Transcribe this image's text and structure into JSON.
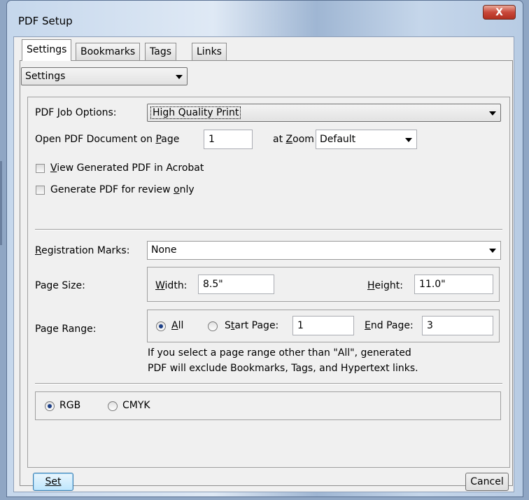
{
  "window": {
    "title": "PDF Setup",
    "close_glyph": "X"
  },
  "tabs": [
    {
      "label": "Settings",
      "active": true
    },
    {
      "label": "Bookmarks",
      "active": false
    },
    {
      "label": "Tags",
      "active": false
    },
    {
      "label": "Links",
      "active": false
    }
  ],
  "category_select": {
    "value": "Settings"
  },
  "job_options": {
    "label": "PDF Job Options:",
    "label_mnemonic": "J",
    "value": "High Quality Print"
  },
  "open_on_page": {
    "label": "Open PDF Document on Page",
    "page_value": "1",
    "zoom_label": "at Zoom",
    "zoom_value": "Default"
  },
  "checkboxes": [
    {
      "label": "View Generated PDF in Acrobat",
      "checked": false
    },
    {
      "label": "Generate PDF for review only",
      "checked": false
    }
  ],
  "registration": {
    "label": "Registration Marks:",
    "value": "None"
  },
  "page_size": {
    "label": "Page Size:",
    "width_label": "Width:",
    "width_value": "8.5\"",
    "height_label": "Height:",
    "height_value": "11.0\""
  },
  "page_range": {
    "label": "Page Range:",
    "all_label": "All",
    "start_label": "Start Page:",
    "start_value": "1",
    "end_label": "End Page:",
    "end_value": "3",
    "selected": "All",
    "note_line1": "If you select a page range other than \"All\",  generated",
    "note_line2": "PDF will exclude Bookmarks, Tags, and Hypertext links."
  },
  "color_mode": {
    "rgb_label": "RGB",
    "cmyk_label": "CMYK",
    "selected": "RGB"
  },
  "buttons": {
    "set": "Set",
    "cancel": "Cancel"
  },
  "colors": {
    "title_bar": "#c5d7ec",
    "close_button": "#c9483a",
    "dialog_bg": "#f0f0f0",
    "radio_dot": "#1c3f86"
  }
}
